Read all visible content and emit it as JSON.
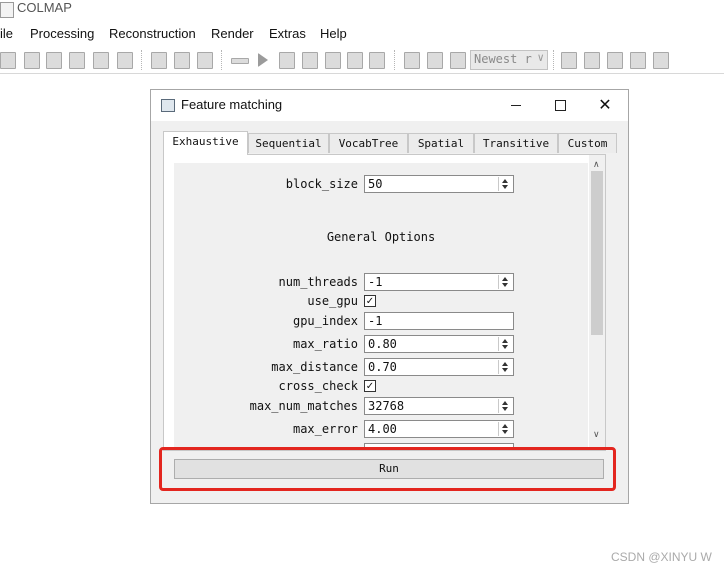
{
  "app": {
    "title": "COLMAP"
  },
  "menubar": {
    "items": [
      "ile",
      "Processing",
      "Reconstruction",
      "Render",
      "Extras",
      "Help"
    ]
  },
  "toolbar": {
    "icons": [
      "new-project-icon",
      "open-project-icon",
      "edit-project-icon",
      "save-project-icon",
      "import-icon",
      "export-icon",
      "feature-extraction-icon",
      "feature-matching-icon",
      "database-icon",
      "play-icon",
      "step-icon",
      "pause-icon",
      "bundle-adjustment-icon",
      "dense-icon",
      "render-options-icon",
      "snapshot-icon",
      "colors-icon",
      "log-icon",
      "grid-icon",
      "chart-icon",
      "window-icon",
      "film-icon"
    ],
    "combo_value": "Newest r"
  },
  "dialog": {
    "title": "Feature matching",
    "tabs": [
      "Exhaustive",
      "Sequential",
      "VocabTree",
      "Spatial",
      "Transitive",
      "Custom"
    ],
    "active_tab": "Exhaustive",
    "fields": {
      "block_size": {
        "label": "block_size",
        "value": "50"
      },
      "section_title": "General Options",
      "num_threads": {
        "label": "num_threads",
        "value": "-1"
      },
      "use_gpu": {
        "label": "use_gpu",
        "checked": true
      },
      "gpu_index": {
        "label": "gpu_index",
        "value": "-1"
      },
      "max_ratio": {
        "label": "max_ratio",
        "value": "0.80"
      },
      "max_distance": {
        "label": "max_distance",
        "value": "0.70"
      },
      "cross_check": {
        "label": "cross_check",
        "checked": true
      },
      "max_num_matches": {
        "label": "max_num_matches",
        "value": "32768"
      },
      "max_error": {
        "label": "max_error",
        "value": "4.00"
      }
    },
    "run_label": "Run"
  },
  "watermark": "CSDN @XINYU W",
  "colors": {
    "highlight": "#e3261f"
  }
}
